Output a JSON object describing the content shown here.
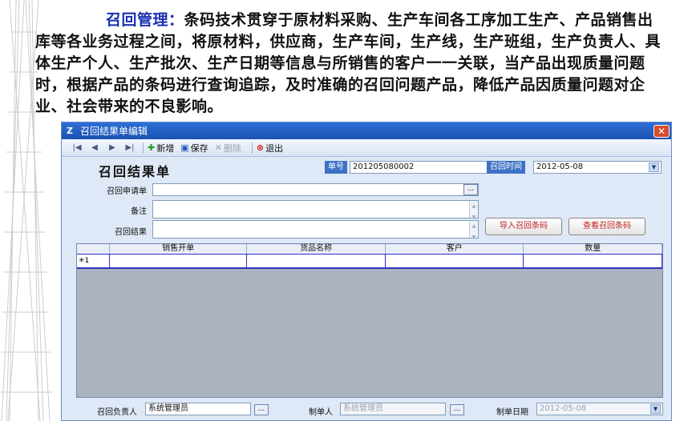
{
  "intro": {
    "heading": "召回管理：",
    "text": "条码技术贯穿于原材料采购、生产车间各工序加工生产、产品销售出库等各业务过程之间，将原材料，供应商，生产车间，生产线，生产班组，生产负责人、具体生产个人、生产批次、生产日期等信息与所销售的客户一一关联，当产品出现质量问题时，根据产品的条码进行查询追踪，及时准确的召回问题产品，降低产品因质量问题对企业、社会带来的不良影响。"
  },
  "window": {
    "title": "召回结果单编辑",
    "close_label": "✕"
  },
  "toolbar": {
    "nav_first": "|◀",
    "nav_prev": "◀",
    "nav_next": "▶",
    "nav_last": "▶|",
    "add_label": "新增",
    "save_label": "保存",
    "delete_label": "删除",
    "exit_label": "退出"
  },
  "form": {
    "title": "召回结果单",
    "doc_no_label": "单号",
    "doc_no_value": "201205080002",
    "recall_time_label": "召回时间",
    "recall_time_value": "2012-05-08",
    "request_label": "召回申请单",
    "request_value": "",
    "remark_label": "备注",
    "remark_value": "",
    "result_label": "召回结果",
    "result_value": "",
    "import_button": "导入召回条码",
    "view_button": "查看召回条码",
    "browse_label": "..."
  },
  "grid": {
    "columns": [
      "销售开单",
      "货品名称",
      "客户",
      "数量"
    ],
    "rows": [
      {
        "marker": "✳1",
        "cells": [
          "",
          "",
          "",
          ""
        ]
      }
    ]
  },
  "footer": {
    "owner_label": "召回负责人",
    "owner_value": "系统管理员",
    "creator_label": "制单人",
    "creator_value": "系统管理员",
    "date_label": "制单日期",
    "date_value": "2012-05-08"
  }
}
